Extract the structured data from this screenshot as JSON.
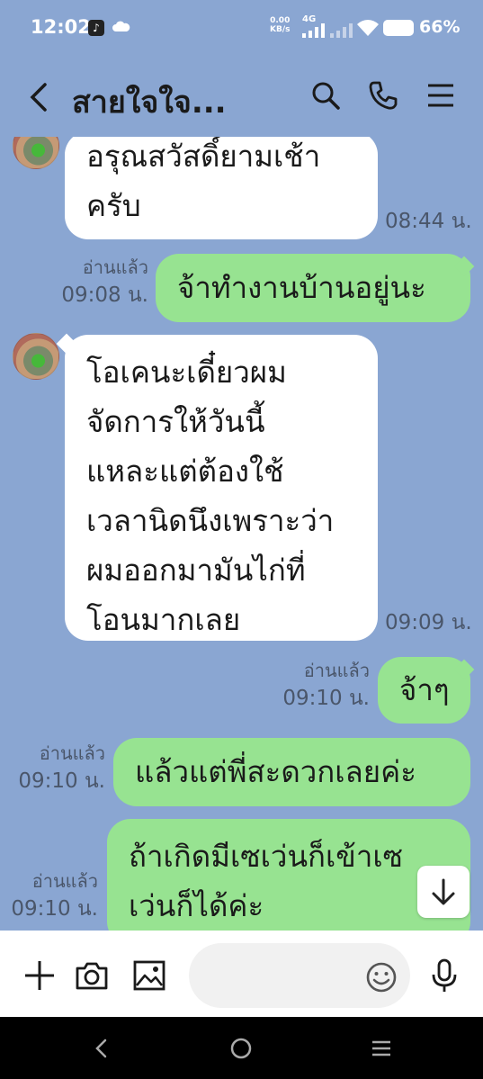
{
  "status_bar": {
    "time": "12:02",
    "net_speed_value": "0.00",
    "net_speed_unit": "KB/s",
    "network": "4G",
    "battery": "66%"
  },
  "header": {
    "title": "สายใจใจ...",
    "icons": [
      "back-icon",
      "search-icon",
      "phone-icon",
      "menu-icon"
    ]
  },
  "messages": [
    {
      "side": "in",
      "lines": [
        "อรุณสวัสดิ์ยามเช้า",
        "ครับ"
      ],
      "time": "08:44 น."
    },
    {
      "side": "out",
      "lines": [
        "จ้าทำงานบ้านอยู่นะ"
      ],
      "read": "อ่านแล้ว",
      "time": "09:08 น."
    },
    {
      "side": "in",
      "lines": [
        "โอเคนะเดี๋ยวผม",
        "จัดการให้วันนี้",
        "แหละแต่ต้องใช้",
        "เวลานิดนึงเพราะว่า",
        "ผมออกมามันไก่ที่",
        "โอนมากเลย"
      ],
      "time": "09:09 น."
    },
    {
      "side": "out",
      "lines": [
        "จ้าๆ"
      ],
      "read": "อ่านแล้ว",
      "time": "09:10 น."
    },
    {
      "side": "out",
      "lines": [
        "แล้วแต่พี่สะดวกเลยค่ะ"
      ],
      "read": "อ่านแล้ว",
      "time": "09:10 น."
    },
    {
      "side": "out",
      "lines": [
        "ถ้าเกิดมีเซเว่นก็เข้าเซ",
        "เว่นก็ได้ค่ะ"
      ],
      "read": "อ่านแล้ว",
      "time": "09:10 น."
    }
  ],
  "input_bar": {
    "placeholder": "",
    "icons": [
      "plus-icon",
      "camera-icon",
      "image-icon",
      "emoji-icon",
      "microphone-icon"
    ]
  },
  "colors": {
    "background": "#8aa6d2",
    "incoming_bubble": "#ffffff",
    "outgoing_bubble": "#97e391",
    "meta_text": "#4a566a"
  }
}
